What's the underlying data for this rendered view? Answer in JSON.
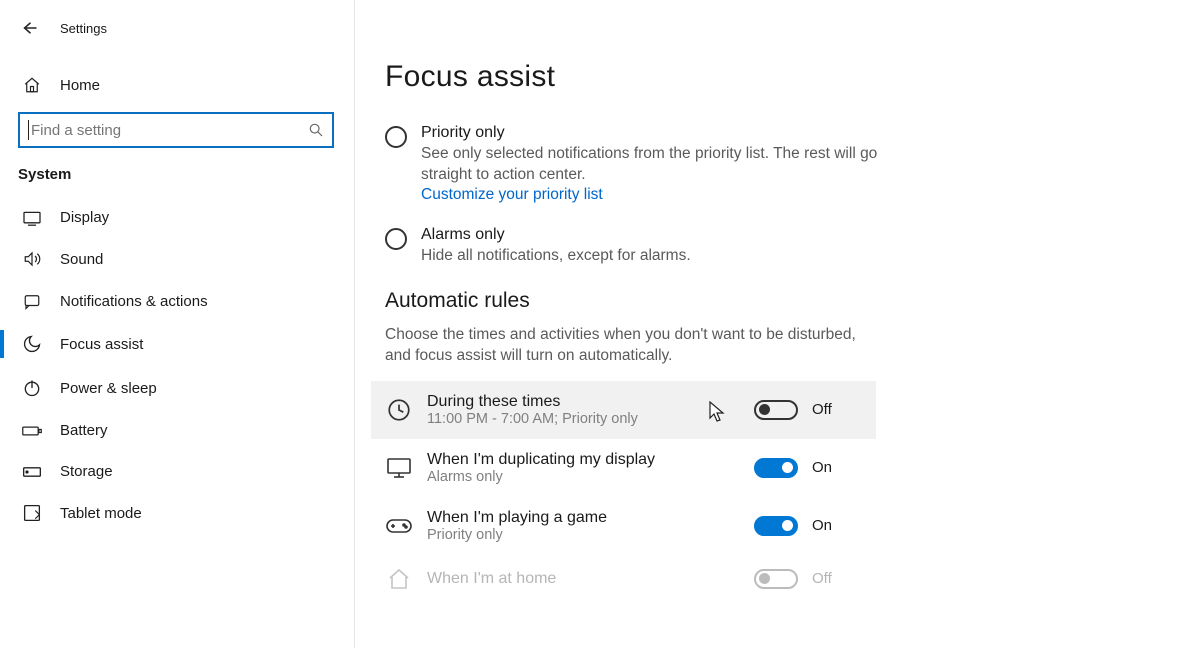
{
  "window": {
    "title": "Settings"
  },
  "sidebar": {
    "home": "Home",
    "search_placeholder": "Find a setting",
    "section": "System",
    "items": [
      {
        "label": "Display"
      },
      {
        "label": "Sound"
      },
      {
        "label": "Notifications & actions"
      },
      {
        "label": "Focus assist"
      },
      {
        "label": "Power & sleep"
      },
      {
        "label": "Battery"
      },
      {
        "label": "Storage"
      },
      {
        "label": "Tablet mode"
      }
    ]
  },
  "main": {
    "title": "Focus assist",
    "radios": {
      "priority": {
        "title": "Priority only",
        "desc": "See only selected notifications from the priority list. The rest will go straight to action center.",
        "link": "Customize your priority list"
      },
      "alarms": {
        "title": "Alarms only",
        "desc": "Hide all notifications, except for alarms."
      }
    },
    "auto": {
      "header": "Automatic rules",
      "desc": "Choose the times and activities when you don't want to be disturbed, and focus assist will turn on automatically.",
      "rules": [
        {
          "title": "During these times",
          "detail": "11:00 PM - 7:00 AM; Priority only",
          "state": "Off"
        },
        {
          "title": "When I'm duplicating my display",
          "detail": "Alarms only",
          "state": "On"
        },
        {
          "title": "When I'm playing a game",
          "detail": "Priority only",
          "state": "On"
        },
        {
          "title": "When I'm at home",
          "detail": "",
          "state": "Off"
        }
      ]
    }
  }
}
